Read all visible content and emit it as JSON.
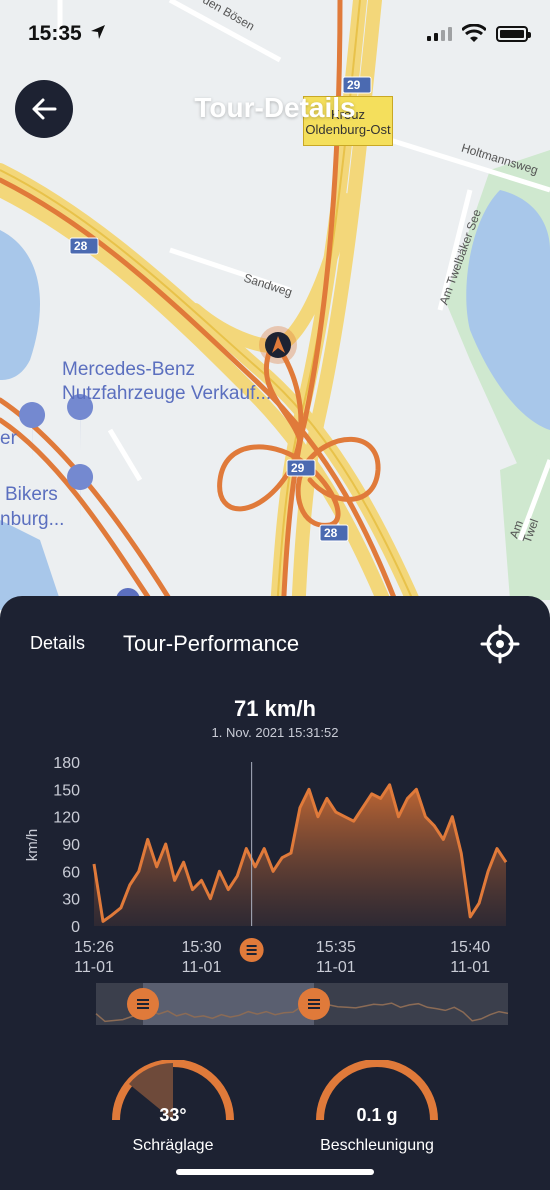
{
  "status_bar": {
    "time": "15:35"
  },
  "header": {
    "title": "Tour-Details"
  },
  "map": {
    "poi": [
      {
        "text": "Mercedes-Benz"
      },
      {
        "text": "Nutzfahrzeuge Verkauf..."
      },
      {
        "text": "er"
      },
      {
        "text": "Bikers"
      },
      {
        "text": "nburg..."
      }
    ],
    "roads": {
      "holtmannsweg": "Holtmannsweg",
      "sandweg": "Sandweg",
      "am_twelbaker_see": "Am Twelbäker See",
      "am_twel": "Am Twel",
      "bosen": "den Bösen"
    },
    "kreuz": {
      "line1": "Kreuz",
      "line2": "Oldenburg-Ost"
    },
    "shields": {
      "a29_top": "29",
      "a28_left": "28",
      "a29_mid": "29",
      "a28_mid": "28"
    }
  },
  "sheet": {
    "tab_details": "Details",
    "tab_performance": "Tour-Performance",
    "readout": {
      "value": "71 km/h",
      "date": "1. Nov. 2021 15:31:52"
    }
  },
  "gauges": {
    "lean": {
      "value": "33°",
      "label": "Schräglage"
    },
    "accel": {
      "value": "0.1 g",
      "label": "Beschleunigung"
    }
  },
  "colors": {
    "accent": "#e07a3a",
    "background": "#1d2232"
  },
  "chart_data": {
    "type": "area",
    "ylabel": "km/h",
    "yticks": [
      "180",
      "150",
      "120",
      "90",
      "60",
      "30",
      "0"
    ],
    "ylim": [
      0,
      180
    ],
    "xlim_minutes": [
      15.433,
      15.683
    ],
    "xticks": [
      {
        "time": "15:26",
        "date": "11-01"
      },
      {
        "time": "15:30",
        "date": "11-01"
      },
      {
        "time": "15:35",
        "date": "11-01"
      },
      {
        "time": "15:40",
        "date": "11-01"
      }
    ],
    "cursor_time": "15:31:52",
    "series": [
      {
        "x": [
          "15:26:00",
          "15:26:20",
          "15:26:40",
          "15:27:00",
          "15:27:20",
          "15:27:40",
          "15:28:00",
          "15:28:20",
          "15:28:40",
          "15:29:00",
          "15:29:20",
          "15:29:40",
          "15:30:00",
          "15:30:20",
          "15:30:40",
          "15:31:00",
          "15:31:20",
          "15:31:40",
          "15:32:00",
          "15:32:20",
          "15:32:40",
          "15:33:00",
          "15:33:20",
          "15:33:40",
          "15:34:00",
          "15:34:20",
          "15:34:40",
          "15:35:00",
          "15:35:20",
          "15:35:40",
          "15:36:00",
          "15:36:20",
          "15:36:40",
          "15:37:00",
          "15:37:20",
          "15:37:40",
          "15:38:00",
          "15:38:20",
          "15:38:40",
          "15:39:00",
          "15:39:20",
          "15:39:40",
          "15:40:00",
          "15:40:20",
          "15:40:40",
          "15:41:00",
          "15:41:20"
        ],
        "values": [
          68,
          5,
          12,
          20,
          45,
          60,
          95,
          65,
          90,
          50,
          70,
          40,
          50,
          30,
          60,
          40,
          55,
          85,
          65,
          85,
          60,
          75,
          80,
          130,
          150,
          120,
          140,
          125,
          120,
          115,
          130,
          145,
          140,
          155,
          120,
          140,
          150,
          120,
          110,
          95,
          120,
          80,
          10,
          25,
          60,
          85,
          70
        ]
      }
    ]
  }
}
